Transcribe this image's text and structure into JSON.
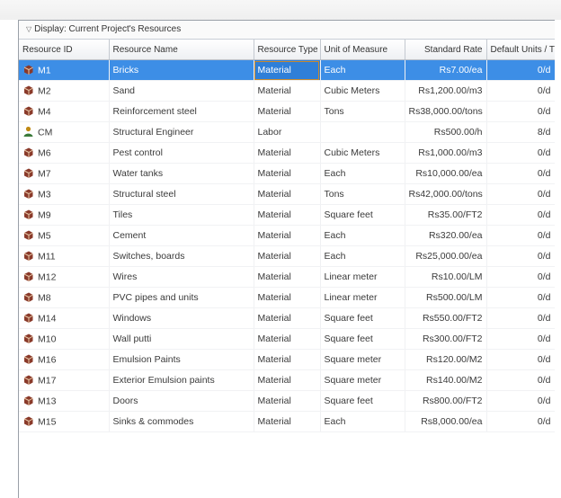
{
  "display_bar": {
    "label": "Display: Current Project's Resources"
  },
  "columns": [
    "Resource ID",
    "Resource Name",
    "Resource Type",
    "Unit of Measure",
    "Standard Rate",
    "Default Units / Time"
  ],
  "rows": [
    {
      "id": "M1",
      "name": "Bricks",
      "type": "Material",
      "unit": "Each",
      "rate": "Rs7.00/ea",
      "units": "0/d",
      "icon": "material-resource-icon",
      "selected": true
    },
    {
      "id": "M2",
      "name": "Sand",
      "type": "Material",
      "unit": "Cubic Meters",
      "rate": "Rs1,200.00/m3",
      "units": "0/d",
      "icon": "material-resource-icon"
    },
    {
      "id": "M4",
      "name": "Reinforcement steel",
      "type": "Material",
      "unit": "Tons",
      "rate": "Rs38,000.00/tons",
      "units": "0/d",
      "icon": "material-resource-icon"
    },
    {
      "id": "CM",
      "name": "Structural Engineer",
      "type": "Labor",
      "unit": "",
      "rate": "Rs500.00/h",
      "units": "8/d",
      "icon": "labor-resource-icon"
    },
    {
      "id": "M6",
      "name": "Pest control",
      "type": "Material",
      "unit": "Cubic Meters",
      "rate": "Rs1,000.00/m3",
      "units": "0/d",
      "icon": "material-resource-icon"
    },
    {
      "id": "M7",
      "name": "Water tanks",
      "type": "Material",
      "unit": "Each",
      "rate": "Rs10,000.00/ea",
      "units": "0/d",
      "icon": "material-resource-icon"
    },
    {
      "id": "M3",
      "name": "Structural steel",
      "type": "Material",
      "unit": "Tons",
      "rate": "Rs42,000.00/tons",
      "units": "0/d",
      "icon": "material-resource-icon"
    },
    {
      "id": "M9",
      "name": "Tiles",
      "type": "Material",
      "unit": "Square feet",
      "rate": "Rs35.00/FT2",
      "units": "0/d",
      "icon": "material-resource-icon"
    },
    {
      "id": "M5",
      "name": "Cement",
      "type": "Material",
      "unit": "Each",
      "rate": "Rs320.00/ea",
      "units": "0/d",
      "icon": "material-resource-icon"
    },
    {
      "id": "M11",
      "name": "Switches, boards",
      "type": "Material",
      "unit": "Each",
      "rate": "Rs25,000.00/ea",
      "units": "0/d",
      "icon": "material-resource-icon"
    },
    {
      "id": "M12",
      "name": "Wires",
      "type": "Material",
      "unit": "Linear meter",
      "rate": "Rs10.00/LM",
      "units": "0/d",
      "icon": "material-resource-icon"
    },
    {
      "id": "M8",
      "name": "PVC pipes and units",
      "type": "Material",
      "unit": "Linear meter",
      "rate": "Rs500.00/LM",
      "units": "0/d",
      "icon": "material-resource-icon"
    },
    {
      "id": "M14",
      "name": "Windows",
      "type": "Material",
      "unit": "Square feet",
      "rate": "Rs550.00/FT2",
      "units": "0/d",
      "icon": "material-resource-icon"
    },
    {
      "id": "M10",
      "name": "Wall putti",
      "type": "Material",
      "unit": "Square feet",
      "rate": "Rs300.00/FT2",
      "units": "0/d",
      "icon": "material-resource-icon"
    },
    {
      "id": "M16",
      "name": "Emulsion Paints",
      "type": "Material",
      "unit": "Square meter",
      "rate": "Rs120.00/M2",
      "units": "0/d",
      "icon": "material-resource-icon"
    },
    {
      "id": "M17",
      "name": "Exterior Emulsion paints",
      "type": "Material",
      "unit": "Square meter",
      "rate": "Rs140.00/M2",
      "units": "0/d",
      "icon": "material-resource-icon"
    },
    {
      "id": "M13",
      "name": "Doors",
      "type": "Material",
      "unit": "Square feet",
      "rate": "Rs800.00/FT2",
      "units": "0/d",
      "icon": "material-resource-icon"
    },
    {
      "id": "M15",
      "name": "Sinks & commodes",
      "type": "Material",
      "unit": "Each",
      "rate": "Rs8,000.00/ea",
      "units": "0/d",
      "icon": "material-resource-icon"
    }
  ],
  "colors": {
    "selection": "#3d8ee6",
    "material_icon": "#8a3a2a",
    "labor_icon": "#c08a14"
  }
}
